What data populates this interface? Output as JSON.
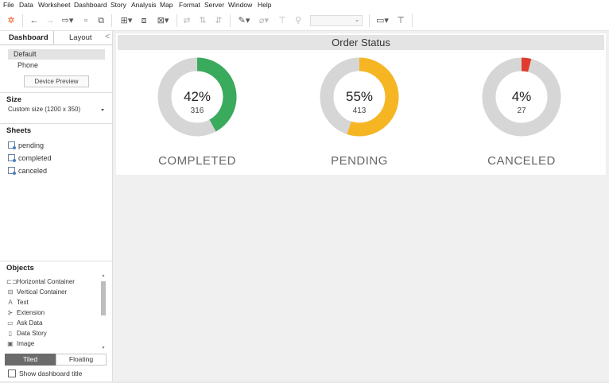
{
  "menu": [
    "File",
    "Data",
    "Worksheet",
    "Dashboard",
    "Story",
    "Analysis",
    "Map",
    "Format",
    "Server",
    "Window",
    "Help"
  ],
  "panel": {
    "tab_dashboard": "Dashboard",
    "tab_layout": "Layout",
    "collapse": "<",
    "devices": [
      "Default",
      "Phone"
    ],
    "device_preview": "Device Preview",
    "size_title": "Size",
    "size_value": "Custom size (1200 x 350)",
    "sheets_title": "Sheets",
    "sheets": [
      "pending",
      "completed",
      "canceled"
    ],
    "objects_title": "Objects",
    "objects": [
      {
        "label": "Horizontal Container",
        "icon": "horizontal-container-icon",
        "glyph": "⊏⊐"
      },
      {
        "label": "Vertical Container",
        "icon": "vertical-container-icon",
        "glyph": "⊟"
      },
      {
        "label": "Text",
        "icon": "text-icon",
        "glyph": "A"
      },
      {
        "label": "Extension",
        "icon": "extension-icon",
        "glyph": "⊱"
      },
      {
        "label": "Ask Data",
        "icon": "ask-data-icon",
        "glyph": "▭"
      },
      {
        "label": "Data Story",
        "icon": "data-story-icon",
        "glyph": "▯"
      },
      {
        "label": "Image",
        "icon": "image-icon",
        "glyph": "▣"
      }
    ],
    "tiled": "Tiled",
    "floating": "Floating",
    "show_title": "Show dashboard title"
  },
  "dashboard": {
    "title": "Order Status",
    "kpis": [
      {
        "pct": "42%",
        "count": "316",
        "label": "COMPLETED",
        "fraction": 0.42,
        "color": "#3aaa5c"
      },
      {
        "pct": "55%",
        "count": "413",
        "label": "PENDING",
        "fraction": 0.55,
        "color": "#f6b623"
      },
      {
        "pct": "4%",
        "count": "27",
        "label": "CANCELED",
        "fraction": 0.04,
        "color": "#e03b2e"
      }
    ],
    "ring_track_color": "#d6d6d6"
  }
}
